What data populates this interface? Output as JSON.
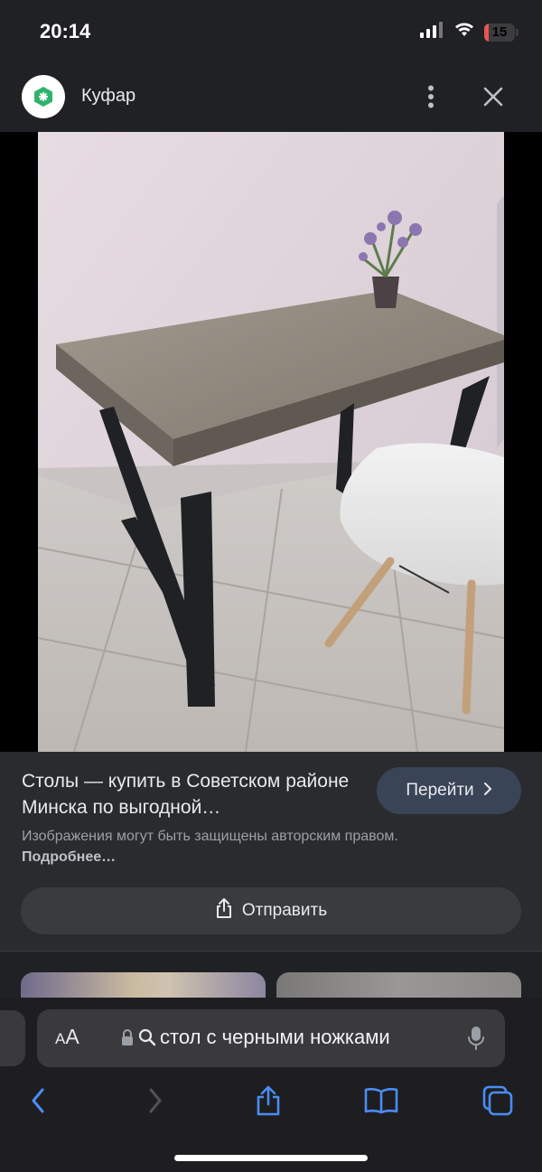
{
  "status_bar": {
    "time": "20:14",
    "battery_level": "15",
    "battery_fraction": 0.15,
    "icons": [
      "cellular-signal-icon",
      "wifi-icon",
      "battery-icon"
    ]
  },
  "header": {
    "site_name": "Куфар",
    "logo_icon": "kufar-logo-icon",
    "menu_icon": "more-vertical-icon",
    "close_icon": "close-icon"
  },
  "main": {
    "lens_icon": "google-lens-icon",
    "result_title": "Столы — купить в Советском районе Минска по выгодной…",
    "visit_label": "Перейти",
    "copyright_text": "Изображения могут быть защищены авторским правом.",
    "copyright_link": "Подробнее…",
    "share_label": "Отправить"
  },
  "browser": {
    "aa_label_small": "A",
    "aa_label_big": "A",
    "address_text": "стол с черными ножками",
    "icons": [
      "lock-icon",
      "search-icon",
      "microphone-icon",
      "back-icon",
      "forward-icon",
      "share-icon",
      "bookmarks-icon",
      "tabs-icon"
    ]
  },
  "colors": {
    "background": "#202124",
    "accent": "#4a8cf7",
    "brand": "#2fb36b",
    "visit_button": "#394457"
  }
}
